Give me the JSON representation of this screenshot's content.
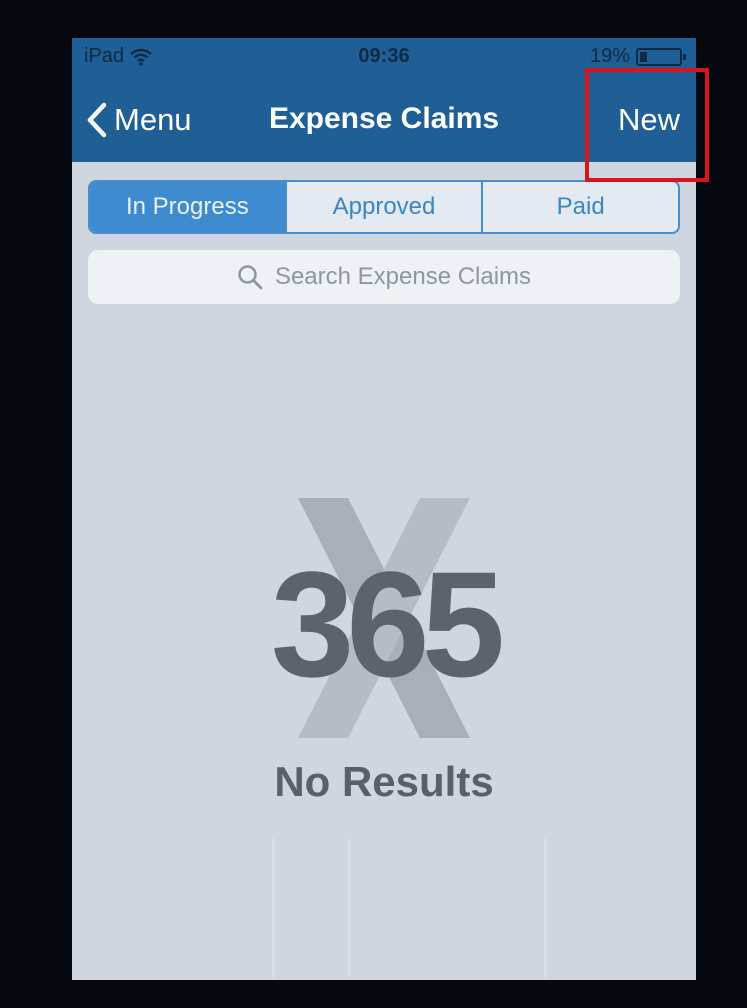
{
  "status_bar": {
    "device": "iPad",
    "time": "09:36",
    "battery_text": "19%",
    "battery_level": 0.19
  },
  "nav": {
    "back_label": "Menu",
    "title": "Expense Claims",
    "new_label": "New"
  },
  "segments": {
    "in_progress": "In Progress",
    "approved": "Approved",
    "paid": "Paid",
    "selected": "In Progress"
  },
  "search": {
    "placeholder": "Search Expense Claims"
  },
  "empty_state": {
    "logo_number": "365",
    "logo_letter": "X",
    "message": "No Results"
  },
  "colors": {
    "nav_bar": "#1f5f96",
    "accent": "#3f8bcf",
    "background": "#cfd6df",
    "highlight": "#d9141a"
  }
}
